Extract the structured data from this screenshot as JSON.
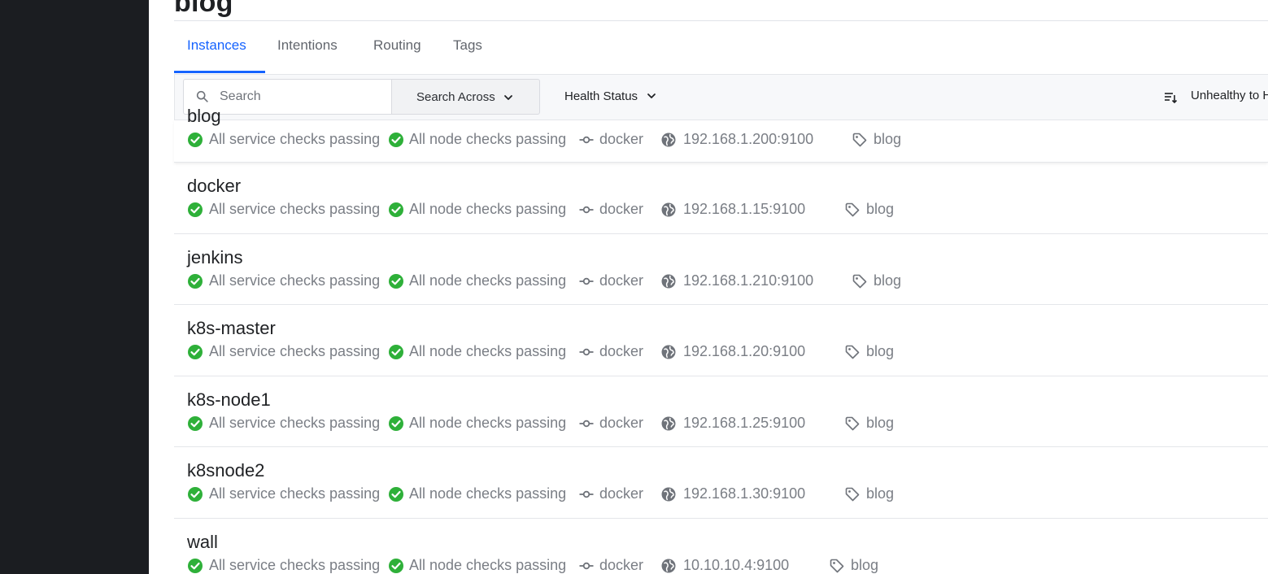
{
  "service": {
    "title": "blog"
  },
  "tabs": [
    {
      "label": "Instances",
      "active": true
    },
    {
      "label": "Intentions",
      "active": false
    },
    {
      "label": "Routing",
      "active": false
    },
    {
      "label": "Tags",
      "active": false
    }
  ],
  "toolbar": {
    "search_placeholder": "Search",
    "search_across_label": "Search Across",
    "health_status_label": "Health Status",
    "sort_label": "Unhealthy to H"
  },
  "instances": [
    {
      "name": "blog",
      "service_checks": "All service checks passing",
      "node_checks": "All node checks passing",
      "node": "docker",
      "address": "192.168.1.200:9100",
      "tag": "blog"
    },
    {
      "name": "docker",
      "service_checks": "All service checks passing",
      "node_checks": "All node checks passing",
      "node": "docker",
      "address": "192.168.1.15:9100",
      "tag": "blog"
    },
    {
      "name": "jenkins",
      "service_checks": "All service checks passing",
      "node_checks": "All node checks passing",
      "node": "docker",
      "address": "192.168.1.210:9100",
      "tag": "blog"
    },
    {
      "name": "k8s-master",
      "service_checks": "All service checks passing",
      "node_checks": "All node checks passing",
      "node": "docker",
      "address": "192.168.1.20:9100",
      "tag": "blog"
    },
    {
      "name": "k8s-node1",
      "service_checks": "All service checks passing",
      "node_checks": "All node checks passing",
      "node": "docker",
      "address": "192.168.1.25:9100",
      "tag": "blog"
    },
    {
      "name": "k8snode2",
      "service_checks": "All service checks passing",
      "node_checks": "All node checks passing",
      "node": "docker",
      "address": "192.168.1.30:9100",
      "tag": "blog"
    },
    {
      "name": "wall",
      "service_checks": "All service checks passing",
      "node_checks": "All node checks passing",
      "node": "docker",
      "address": "10.10.10.4:9100",
      "tag": "blog"
    }
  ],
  "colors": {
    "accent": "#1563ff",
    "passing": "#2eb039",
    "sidebar": "#1b1d21",
    "muted_text": "#7a7e85"
  },
  "icons": {
    "status": "check-circle-icon",
    "node": "git-commit-icon",
    "address": "globe-icon",
    "tag": "tag-icon",
    "search": "search-icon",
    "sort": "sort-icon",
    "dropdown": "chevron-down-icon"
  }
}
